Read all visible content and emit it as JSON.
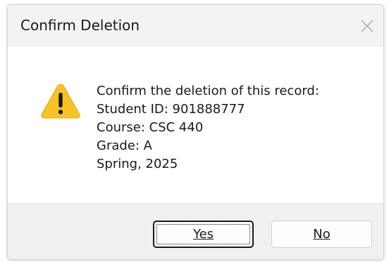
{
  "dialog": {
    "title": "Confirm Deletion",
    "close_icon": "close-icon",
    "warning_icon": "warning-icon",
    "message": {
      "line1": "Confirm the deletion of this record:",
      "line2": "Student ID: 901888777",
      "line3": "Course: CSC 440",
      "line4": "Grade: A",
      "line5": "Spring, 2025"
    },
    "buttons": {
      "yes_label": "Yes",
      "no_label": "No"
    }
  },
  "colors": {
    "warning_fill": "#F7C324",
    "warning_mark": "#1a1a1a",
    "title_bar_bg": "#F3F3F3",
    "footer_bg": "#F0F0F0"
  }
}
